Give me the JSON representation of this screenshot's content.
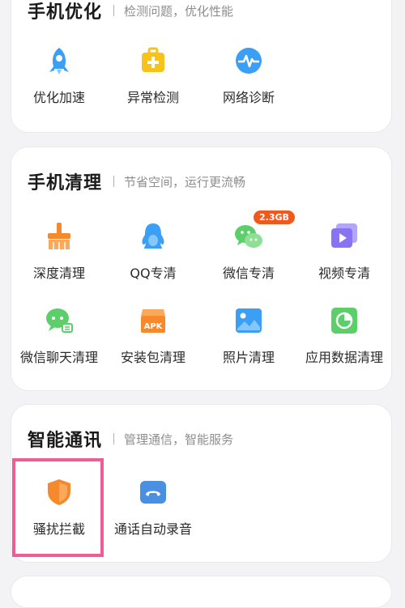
{
  "sections": {
    "optimize": {
      "title": "手机优化",
      "subtitle": "检测问题，优化性能",
      "items": [
        {
          "label": "优化加速",
          "icon": "rocket-icon"
        },
        {
          "label": "异常检测",
          "icon": "medical-kit-icon"
        },
        {
          "label": "网络诊断",
          "icon": "network-pulse-icon"
        }
      ]
    },
    "clean": {
      "title": "手机清理",
      "subtitle": "节省空间，运行更流畅",
      "items": [
        {
          "label": "深度清理",
          "icon": "broom-icon"
        },
        {
          "label": "QQ专清",
          "icon": "qq-penguin-icon"
        },
        {
          "label": "微信专清",
          "icon": "wechat-icon",
          "badge": "2.3GB"
        },
        {
          "label": "视频专清",
          "icon": "video-play-icon"
        },
        {
          "label": "微信聊天清理",
          "icon": "wechat-chat-icon"
        },
        {
          "label": "安装包清理",
          "icon": "apk-box-icon",
          "icon_text": "APK"
        },
        {
          "label": "照片清理",
          "icon": "photo-icon"
        },
        {
          "label": "应用数据清理",
          "icon": "pie-chart-icon"
        }
      ]
    },
    "comm": {
      "title": "智能通讯",
      "subtitle": "管理通信，智能服务",
      "items": [
        {
          "label": "骚扰拦截",
          "icon": "shield-icon",
          "highlighted": true
        },
        {
          "label": "通话自动录音",
          "icon": "phone-record-icon"
        }
      ]
    }
  },
  "colors": {
    "blue": "#3b9ff5",
    "yellow": "#f7c21c",
    "orange": "#f6892b",
    "green": "#5ccf6b",
    "purple": "#8a73f0",
    "highlight": "#ee5d95"
  }
}
